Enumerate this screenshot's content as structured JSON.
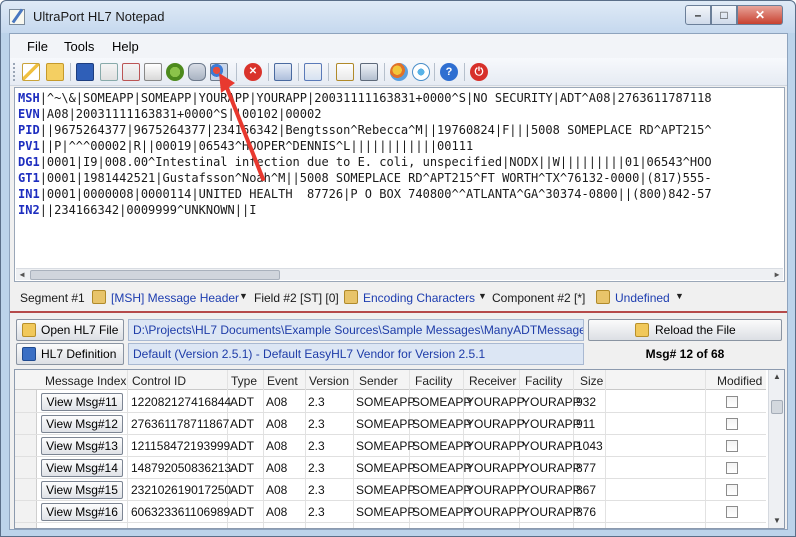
{
  "window": {
    "title": "UltraPort HL7 Notepad"
  },
  "menu": [
    "File",
    "Tools",
    "Help"
  ],
  "toolbar_icons": [
    "new-icon",
    "open-folder-icon",
    "save-icon",
    "import-icon",
    "export-icon",
    "find-icon",
    "settings-gear-icon",
    "database-icon",
    "segment-view-icon",
    "stop-icon",
    "grid-icon",
    "edit-icon",
    "copy-icon",
    "print-icon",
    "palette-icon",
    "connect-icon",
    "help-icon",
    "power-icon"
  ],
  "editor": {
    "lines": [
      {
        "seg": "MSH",
        "text": "|^~\\&|SOMEAPP|SOMEAPP|YOURAPP|YOURAPP|20031111163831+0000^S|NO SECURITY|ADT^A08|2763611787118"
      },
      {
        "seg": "EVN",
        "text": "|A08|20031111163831+0000^S||00102|00002"
      },
      {
        "seg": "PID",
        "text": "||9675264377|9675264377|234166342|Bengtsson^Rebecca^M||19760824|F|||5008 SOMEPLACE RD^APT215^"
      },
      {
        "seg": "PV1",
        "text": "||P|^^^00002|R||00019|06543^HOOPER^DENNIS^L||||||||||||00111"
      },
      {
        "seg": "DG1",
        "text": "|0001|I9|008.00^Intestinal infection due to E. coli, unspecified|NODX||W|||||||||01|06543^HOO"
      },
      {
        "seg": "GT1",
        "text": "|0001|1981442521|Gustafsson^Noah^M||5008 SOMEPLACE RD^APT215^FT WORTH^TX^76132-0000|(817)555-"
      },
      {
        "seg": "IN1",
        "text": "|0001|0000008|0000114|UNITED HEALTH  87726|P O BOX 740800^^ATLANTA^GA^30374-0800||(800)842-57"
      },
      {
        "seg": "IN2",
        "text": "||234166342|0009999^UNKNOWN||I"
      }
    ]
  },
  "segbar": {
    "segment_label": "Segment #1",
    "segment_value": "[MSH] Message Header",
    "field_label": "Field #2 [ST] [0]",
    "field_value": "Encoding Characters",
    "component_label": "Component #2 [*]",
    "component_value": "Undefined"
  },
  "files": {
    "open_label": "Open HL7 File",
    "open_path": "D:\\Projects\\HL7 Documents\\Example Sources\\Sample Messages\\ManyADTMessages.hl7",
    "reload_label": "Reload the File",
    "def_label": "HL7 Definition",
    "def_value": "Default (Version 2.5.1) - Default EasyHL7 Vendor for Version 2.5.1",
    "msg_counter": "Msg# 12 of 68"
  },
  "grid": {
    "columns": [
      "Message Index",
      "Control ID",
      "Type",
      "Event",
      "Version",
      "Sender",
      "Facility",
      "Receiver",
      "Facility",
      "Size",
      "Modified"
    ],
    "rows": [
      {
        "view": "View Msg#11",
        "control": "122082127416844",
        "type": "ADT",
        "event": "A08",
        "version": "2.3",
        "sender": "SOMEAPP",
        "facility": "SOMEAPP",
        "receiver": "YOURAPP",
        "rfacility": "YOURAPP",
        "size": "932"
      },
      {
        "view": "View Msg#12",
        "control": "276361178711867",
        "type": "ADT",
        "event": "A08",
        "version": "2.3",
        "sender": "SOMEAPP",
        "facility": "SOMEAPP",
        "receiver": "YOURAPP",
        "rfacility": "YOURAPP",
        "size": "911"
      },
      {
        "view": "View Msg#13",
        "control": "121158472193999",
        "type": "ADT",
        "event": "A08",
        "version": "2.3",
        "sender": "SOMEAPP",
        "facility": "SOMEAPP",
        "receiver": "YOURAPP",
        "rfacility": "YOURAPP",
        "size": "1043"
      },
      {
        "view": "View Msg#14",
        "control": "148792050836213",
        "type": "ADT",
        "event": "A08",
        "version": "2.3",
        "sender": "SOMEAPP",
        "facility": "SOMEAPP",
        "receiver": "YOURAPP",
        "rfacility": "YOURAPP",
        "size": "877"
      },
      {
        "view": "View Msg#15",
        "control": "232102619017250",
        "type": "ADT",
        "event": "A08",
        "version": "2.3",
        "sender": "SOMEAPP",
        "facility": "SOMEAPP",
        "receiver": "YOURAPP",
        "rfacility": "YOURAPP",
        "size": "867"
      },
      {
        "view": "View Msg#16",
        "control": "606323361106989",
        "type": "ADT",
        "event": "A08",
        "version": "2.3",
        "sender": "SOMEAPP",
        "facility": "SOMEAPP",
        "receiver": "YOURAPP",
        "rfacility": "YOURAPP",
        "size": "876"
      }
    ]
  },
  "colors": {
    "accent_link": "#1e3ca8",
    "segment_id": "#1d2dbf",
    "arrow": "#e8392f"
  }
}
